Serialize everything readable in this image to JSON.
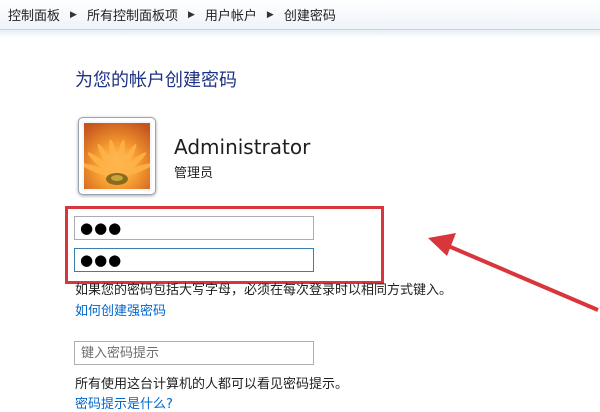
{
  "breadcrumb": {
    "items": [
      "控制面板",
      "所有控制面板项",
      "用户帐户",
      "创建密码"
    ],
    "separator": "▶"
  },
  "page_title": "为您的帐户创建密码",
  "user": {
    "name": "Administrator",
    "role": "管理员"
  },
  "password_fields": {
    "new_password_value": "●●●",
    "confirm_password_value": "●●●"
  },
  "case_note": "如果您的密码包括大写字母，必须在每次登录时以相同方式键入。",
  "strong_password_link": "如何创建强密码",
  "hint": {
    "placeholder": "键入密码提示",
    "note": "所有使用这台计算机的人都可以看见密码提示。",
    "link": "密码提示是什么?"
  },
  "annotation": {
    "highlight_color": "#d9363b",
    "arrow_color": "#d9363b"
  }
}
